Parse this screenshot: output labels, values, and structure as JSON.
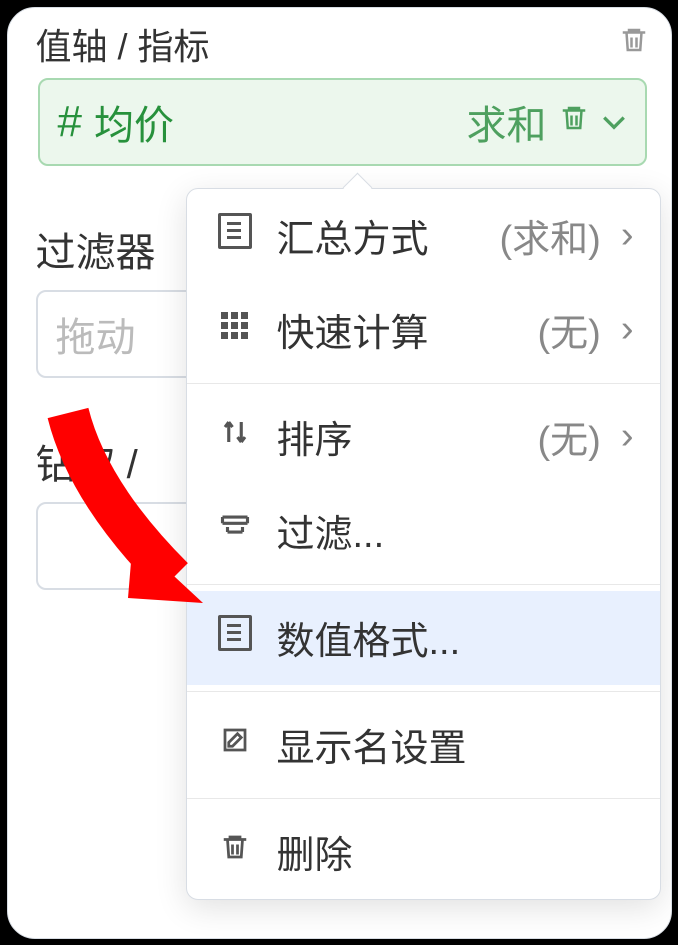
{
  "section_header": "值轴 / 指标",
  "field_pill": {
    "hash": "#",
    "name": "均价",
    "agg_label": "求和"
  },
  "filter_section_title": "过滤器",
  "filter_placeholder": "拖动",
  "drill_section_title": "钻取 /",
  "popover": {
    "items": [
      {
        "icon": "list",
        "label": "汇总方式",
        "extra": "(求和)",
        "chevron": true,
        "highlight": false
      },
      {
        "icon": "grid",
        "label": "快速计算",
        "extra": "(无)",
        "chevron": true,
        "highlight": false
      },
      {
        "divider": true
      },
      {
        "icon": "sort",
        "label": "排序",
        "extra": "(无)",
        "chevron": true,
        "highlight": false
      },
      {
        "icon": "filter",
        "label": "过滤...",
        "extra": "",
        "chevron": false,
        "highlight": false
      },
      {
        "divider": true
      },
      {
        "icon": "list",
        "label": "数值格式...",
        "extra": "",
        "chevron": false,
        "highlight": true
      },
      {
        "divider": true
      },
      {
        "icon": "edit",
        "label": "显示名设置",
        "extra": "",
        "chevron": false,
        "highlight": false
      },
      {
        "divider": true
      },
      {
        "icon": "trash",
        "label": "删除",
        "extra": "",
        "chevron": false,
        "highlight": false
      }
    ]
  },
  "arrow_color": "#ff0000"
}
